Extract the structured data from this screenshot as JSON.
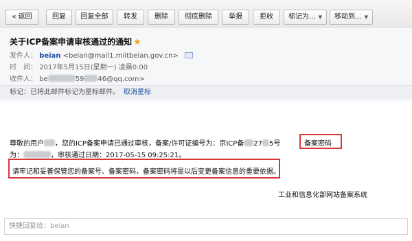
{
  "toolbar": {
    "back": "« 返回",
    "reply": "回复",
    "reply_all": "回复全部",
    "forward": "转发",
    "delete": "删除",
    "purge": "彻底删除",
    "report": "举报",
    "reject": "拒收",
    "mark_as": "标记为...",
    "move_to": "移动到..."
  },
  "email": {
    "subject": "关于ICP备案申请审核通过的通知",
    "star": "★",
    "from_label": "发件人：",
    "from_name": "beian",
    "from_addr": "<beian@mail1.miitbeian.gov.cn>",
    "time_label": "时　间：",
    "time_value": "2017年5月15日(星期一) 凌晨0:00",
    "to_label": "收件人：",
    "to_prefix": "be",
    "to_mid": "59",
    "to_suffix": "46@qq.com>",
    "flag_label": "标记：",
    "flag_text": "已将此邮件标记为星标邮件。",
    "unstar": "取消星标"
  },
  "body": {
    "greeting": "尊敬的用户",
    "line1_middle": "，您的ICP备案申请已通过审核，备案/许可证编号为：京ICP备",
    "line1_num": "27",
    "line1_tail": "5号",
    "password_label": "备案密码",
    "line2_prefix": "为：",
    "line2_text": "，审核通过日期：2017-05-15 09:25:21。",
    "note": "请牢记和妥善保管您的备案号、备案密码，备案密码将是以后变更备案信息的重要依据。",
    "signature": "工业和信息化部网站备案系统"
  },
  "quick_reply": {
    "placeholder": "快捷回复给：beian"
  },
  "colors": {
    "highlight_box": "#d8383a",
    "star": "#f0a31f",
    "link": "#1e4ea0"
  }
}
